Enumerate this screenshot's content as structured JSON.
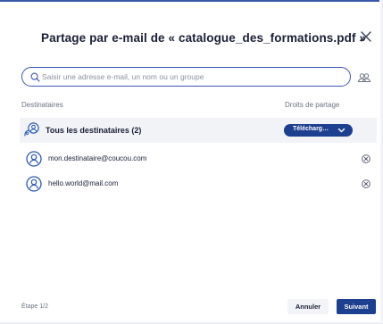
{
  "dialog": {
    "title": "Partage par e-mail de « catalogue_des_formations.pdf »"
  },
  "search": {
    "placeholder": "Saisir une adresse e-mail, un nom ou un groupe",
    "value": ""
  },
  "columns": {
    "recipients": "Destinataires",
    "rights": "Droits de partage"
  },
  "all_recipients": {
    "label": "Tous les destinataires (2)",
    "rights_value": "Télécharg…"
  },
  "recipients": [
    {
      "email": "mon.destinataire@coucou.com"
    },
    {
      "email": "hello.world@mail.com"
    }
  ],
  "footer": {
    "step": "Étape 1/2",
    "cancel_label": "Annuler",
    "next_label": "Suivant"
  },
  "icons": {
    "close": "close-icon",
    "search": "search-icon",
    "contacts": "contacts-icon",
    "group": "group-users-icon",
    "avatar": "user-avatar-icon",
    "remove": "remove-circle-icon",
    "chevron": "chevron-down-icon"
  },
  "colors": {
    "primary": "#1d3f8f",
    "search_border": "#3d57b4",
    "user_icon": "#2b59b7",
    "row_highlight": "#f1f3f7"
  }
}
